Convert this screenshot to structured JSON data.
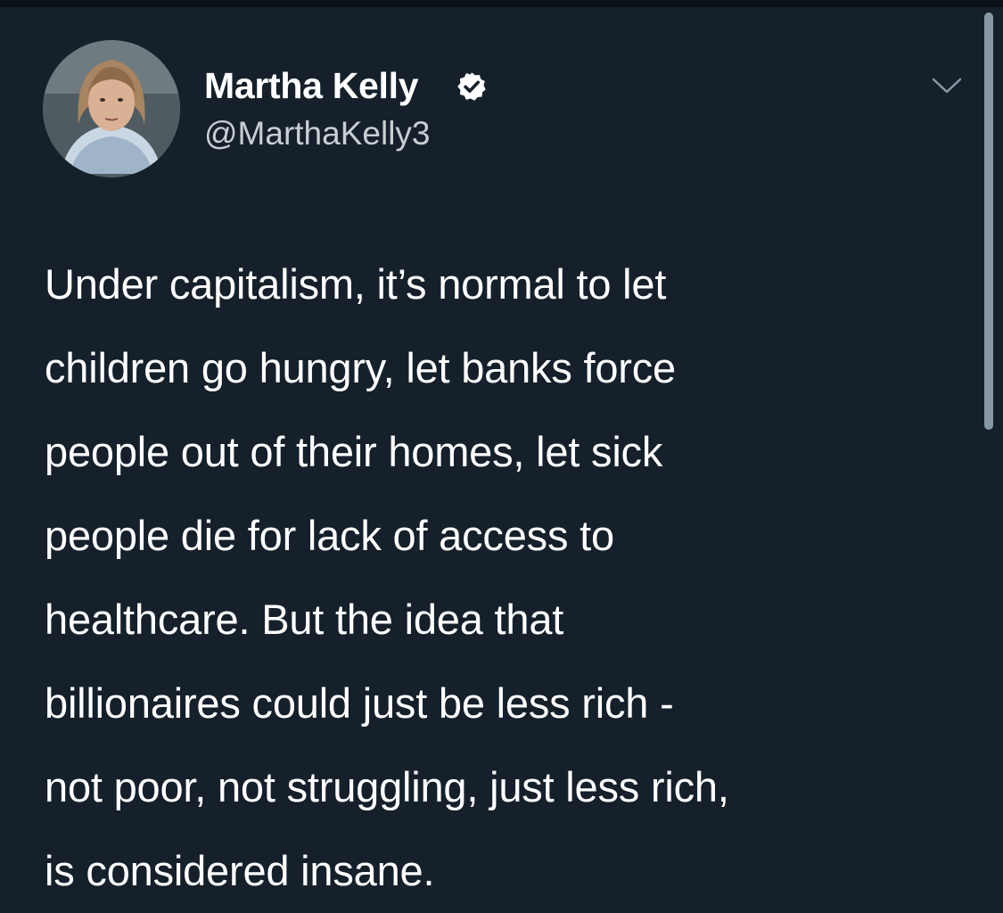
{
  "author": {
    "name": "Martha Kelly",
    "handle": "@MarthaKelly3",
    "verified": true
  },
  "tweet": {
    "lines": [
      "Under capitalism, it’s normal to let",
      "children go hungry, let banks force",
      "people out of their homes, let sick",
      "people die for lack of access to",
      "healthcare. But the idea that",
      "billionaires could just be less rich -",
      "not poor, not struggling, just less rich,",
      "is considered insane."
    ]
  },
  "icons": {
    "verified": "verified-badge-icon",
    "more": "chevron-down-icon"
  },
  "colors": {
    "background": "#15202b",
    "text": "#ffffff",
    "secondary_text": "#c9ced3"
  }
}
